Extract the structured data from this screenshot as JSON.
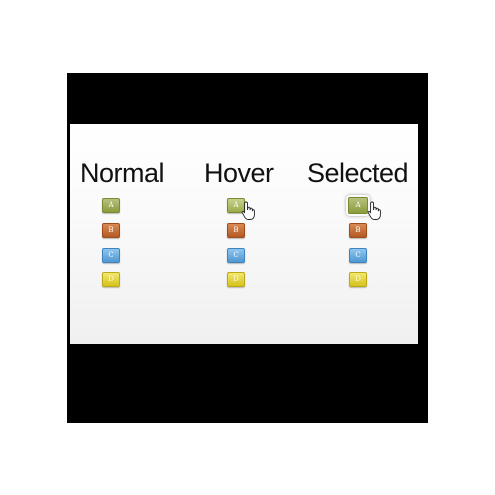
{
  "columns": [
    {
      "title": "Normal",
      "buttons": [
        "A",
        "B",
        "C",
        "D"
      ]
    },
    {
      "title": "Hover",
      "buttons": [
        "A",
        "B",
        "C",
        "D"
      ]
    },
    {
      "title": "Selected",
      "buttons": [
        "A",
        "B",
        "C",
        "D"
      ]
    }
  ],
  "states": {
    "hover_column": "Hover",
    "hover_button": "A",
    "selected_column": "Selected",
    "selected_button": "A"
  },
  "colors": {
    "a": "#8a9b3e",
    "b": "#b35a24",
    "c": "#4f97d2",
    "d": "#d4c21c",
    "frame": "#000000"
  },
  "icons": [
    "hand-pointer-icon"
  ]
}
